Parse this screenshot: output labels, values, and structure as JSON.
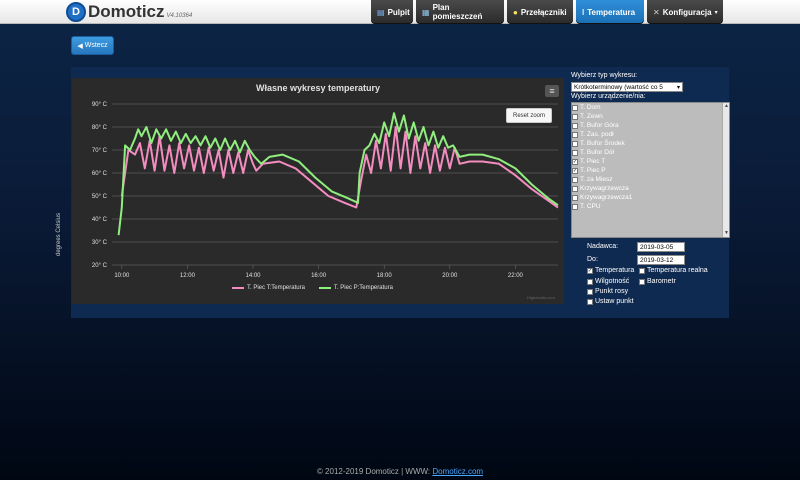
{
  "app": {
    "name": "Domoticz",
    "version": "V4.10364",
    "logo_letter": "D"
  },
  "nav": [
    {
      "label": "Pulpit",
      "icon": "dashboard-icon",
      "active": false
    },
    {
      "label": "Plan pomieszczeń",
      "icon": "floorplan-icon",
      "active": false
    },
    {
      "label": "Przełączniki",
      "icon": "lightbulb-icon",
      "active": false
    },
    {
      "label": "Temperatura",
      "icon": "thermometer-icon",
      "active": true
    },
    {
      "label": "Konfiguracja",
      "icon": "wrench-icon",
      "active": false
    }
  ],
  "back_button": "Wstecz",
  "chart": {
    "menu_glyph": "≡",
    "reset_zoom": "Reset zoom",
    "credits": "Highcharts.com"
  },
  "chart_data": {
    "type": "line",
    "title": "Własne wykresy temperatury",
    "ylabel": "degrees Celsius",
    "ylim": [
      20,
      90
    ],
    "yticks": [
      "90° C",
      "80° C",
      "70° C",
      "60° C",
      "50° C",
      "40° C",
      "30° C",
      "20° C"
    ],
    "xticks": [
      "10:00",
      "12:00",
      "14:00",
      "16:00",
      "18:00",
      "20:00",
      "22:00"
    ],
    "xlim": [
      9.7,
      23.3
    ],
    "series": [
      {
        "name": "T. Piec T:Temperatura",
        "color": "#f38cbf",
        "points": [
          [
            10.0,
            50
          ],
          [
            10.2,
            70
          ],
          [
            10.4,
            68
          ],
          [
            10.55,
            73
          ],
          [
            10.7,
            62
          ],
          [
            10.85,
            74
          ],
          [
            11.0,
            61
          ],
          [
            11.15,
            76
          ],
          [
            11.3,
            61
          ],
          [
            11.45,
            72
          ],
          [
            11.6,
            60
          ],
          [
            11.75,
            73
          ],
          [
            11.9,
            62
          ],
          [
            12.05,
            72
          ],
          [
            12.2,
            61
          ],
          [
            12.35,
            71
          ],
          [
            12.5,
            60
          ],
          [
            12.65,
            71
          ],
          [
            12.8,
            61
          ],
          [
            12.95,
            70
          ],
          [
            13.1,
            58
          ],
          [
            13.25,
            70
          ],
          [
            13.4,
            60
          ],
          [
            13.55,
            69
          ],
          [
            13.7,
            60
          ],
          [
            13.85,
            70
          ],
          [
            14.0,
            64
          ],
          [
            14.1,
            61
          ],
          [
            14.3,
            64
          ],
          [
            14.8,
            65
          ],
          [
            15.3,
            62
          ],
          [
            15.8,
            56
          ],
          [
            16.3,
            50
          ],
          [
            16.8,
            47
          ],
          [
            17.15,
            45
          ],
          [
            17.3,
            57
          ],
          [
            17.45,
            68
          ],
          [
            17.6,
            60
          ],
          [
            17.75,
            74
          ],
          [
            17.9,
            62
          ],
          [
            18.05,
            77
          ],
          [
            18.2,
            61
          ],
          [
            18.35,
            80
          ],
          [
            18.5,
            62
          ],
          [
            18.65,
            78
          ],
          [
            18.8,
            60
          ],
          [
            18.95,
            76
          ],
          [
            19.1,
            62
          ],
          [
            19.25,
            73
          ],
          [
            19.4,
            60
          ],
          [
            19.55,
            72
          ],
          [
            19.7,
            61
          ],
          [
            19.85,
            71
          ],
          [
            20.0,
            62
          ],
          [
            20.15,
            71
          ],
          [
            20.3,
            64
          ],
          [
            20.6,
            65
          ],
          [
            21.0,
            65
          ],
          [
            21.5,
            64
          ],
          [
            22.0,
            59
          ],
          [
            22.5,
            53
          ],
          [
            23.0,
            48
          ],
          [
            23.3,
            45
          ]
        ]
      },
      {
        "name": "T. Piec P:Temperatura",
        "color": "#90ee7e",
        "points": [
          [
            9.9,
            33
          ],
          [
            10.0,
            45
          ],
          [
            10.1,
            72
          ],
          [
            10.25,
            70
          ],
          [
            10.4,
            75
          ],
          [
            10.5,
            79
          ],
          [
            10.6,
            76
          ],
          [
            10.75,
            80
          ],
          [
            10.9,
            73
          ],
          [
            11.05,
            79
          ],
          [
            11.2,
            75
          ],
          [
            11.35,
            79
          ],
          [
            11.5,
            74
          ],
          [
            11.65,
            78
          ],
          [
            11.8,
            73
          ],
          [
            11.95,
            77
          ],
          [
            12.1,
            73
          ],
          [
            12.25,
            76
          ],
          [
            12.4,
            72
          ],
          [
            12.55,
            76
          ],
          [
            12.7,
            71
          ],
          [
            12.85,
            75
          ],
          [
            13.0,
            70
          ],
          [
            13.15,
            75
          ],
          [
            13.3,
            70
          ],
          [
            13.45,
            74
          ],
          [
            13.6,
            69
          ],
          [
            13.75,
            74
          ],
          [
            13.9,
            70
          ],
          [
            14.05,
            67
          ],
          [
            14.25,
            64
          ],
          [
            14.5,
            67
          ],
          [
            14.9,
            68
          ],
          [
            15.4,
            65
          ],
          [
            15.9,
            58
          ],
          [
            16.4,
            52
          ],
          [
            16.9,
            49
          ],
          [
            17.2,
            47
          ],
          [
            17.25,
            60
          ],
          [
            17.4,
            70
          ],
          [
            17.55,
            72
          ],
          [
            17.7,
            77
          ],
          [
            17.85,
            73
          ],
          [
            18.0,
            82
          ],
          [
            18.15,
            76
          ],
          [
            18.3,
            86
          ],
          [
            18.45,
            78
          ],
          [
            18.6,
            85
          ],
          [
            18.75,
            75
          ],
          [
            18.9,
            82
          ],
          [
            19.05,
            74
          ],
          [
            19.2,
            80
          ],
          [
            19.35,
            72
          ],
          [
            19.5,
            78
          ],
          [
            19.65,
            71
          ],
          [
            19.8,
            76
          ],
          [
            19.95,
            71
          ],
          [
            20.1,
            72
          ],
          [
            20.3,
            67
          ],
          [
            20.6,
            68
          ],
          [
            21.0,
            68
          ],
          [
            21.5,
            66
          ],
          [
            22.0,
            62
          ],
          [
            22.5,
            55
          ],
          [
            23.0,
            49
          ],
          [
            23.3,
            46
          ]
        ]
      }
    ]
  },
  "side": {
    "chart_type_label": "Wybierz typ wykresu:",
    "chart_type_value": "Krótkoterminowy (wartość co 5",
    "devices_label": "Wybierz urządzenie/nia:",
    "devices": [
      {
        "label": "T. Dom",
        "checked": false
      },
      {
        "label": "T. Zewn",
        "checked": false
      },
      {
        "label": "T. Bufor Góra",
        "checked": false
      },
      {
        "label": "T. Zas. podł",
        "checked": false
      },
      {
        "label": "T. Bufor Środek",
        "checked": false
      },
      {
        "label": "T. Bufor Dół",
        "checked": false
      },
      {
        "label": "T. Piec T",
        "checked": true
      },
      {
        "label": "T. Piec P",
        "checked": true
      },
      {
        "label": "T. za Miesz",
        "checked": false
      },
      {
        "label": "Krzywagrzewcza",
        "checked": false
      },
      {
        "label": "Krzywagrzewcza1",
        "checked": false
      },
      {
        "label": "T. CPU",
        "checked": false
      }
    ],
    "from_label": "Nadawca:",
    "from_value": "2019-03-05",
    "to_label": "Do:",
    "to_value": "2019-03-12",
    "options": [
      {
        "label": "Temperatura",
        "checked": true
      },
      {
        "label": "Temperatura realna",
        "checked": false
      },
      {
        "label": "Wilgotność",
        "checked": false
      },
      {
        "label": "Barometr",
        "checked": false
      },
      {
        "label": "Punkt rosy",
        "checked": false
      },
      {
        "label": "Ustaw punkt",
        "checked": false
      }
    ]
  },
  "footer": {
    "text": "© 2012-2019 Domoticz | WWW:",
    "link": "Domoticz.com"
  }
}
